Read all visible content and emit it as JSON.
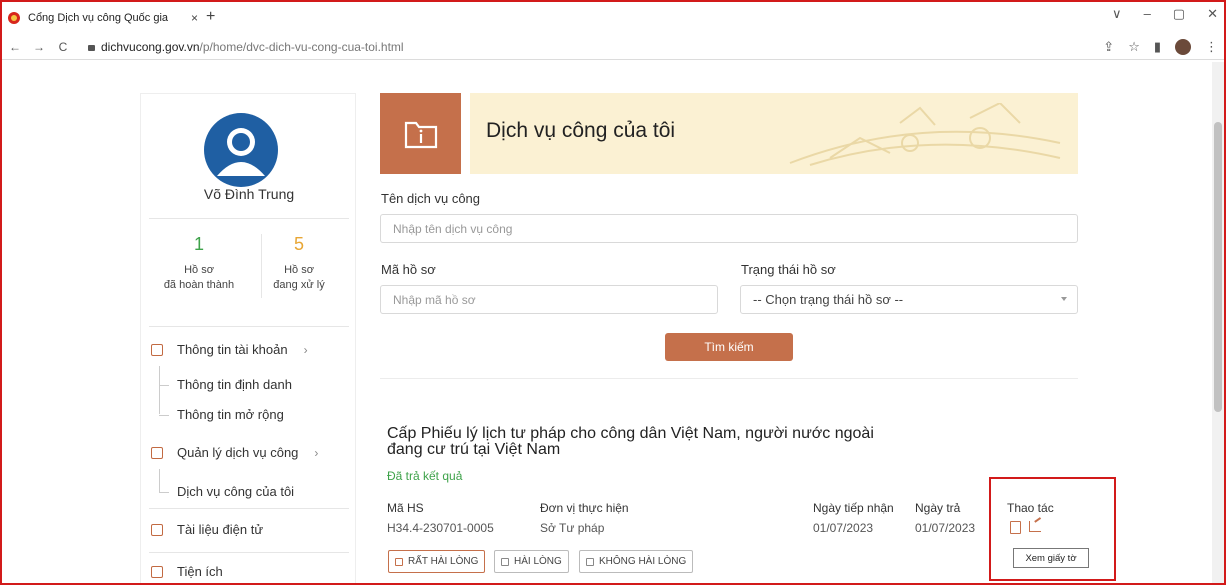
{
  "browser": {
    "tab_title": "Cổng Dịch vụ công Quốc gia",
    "tab_close": "×",
    "new_tab": "+",
    "url_host": "dichvucong.gov.vn",
    "url_path": "/p/home/dvc-dich-vu-cong-cua-toi.html",
    "window_controls": [
      "∨",
      "–",
      "▢",
      "✕"
    ]
  },
  "sidebar": {
    "user_name": "Võ Đình Trung",
    "stats": [
      {
        "value": "1",
        "label_line1": "Hồ sơ",
        "label_line2": "đã hoàn thành",
        "color": "#3ea24a"
      },
      {
        "value": "5",
        "label_line1": "Hồ sơ",
        "label_line2": "đang xử lý",
        "color": "#e8a634"
      }
    ],
    "menu": {
      "account": "Thông tin tài khoản",
      "account_sub": [
        "Thông tin định danh",
        "Thông tin mở rộng"
      ],
      "services": "Quản lý dịch vụ công",
      "services_sub": [
        "Dịch vụ công của tôi"
      ],
      "documents": "Tài liệu điện tử",
      "utilities": "Tiện ích"
    }
  },
  "main": {
    "banner_title": "Dịch vụ công của tôi",
    "service_name_label": "Tên dịch vụ công",
    "service_name_placeholder": "Nhập tên dịch vụ công",
    "case_code_label": "Mã hồ sơ",
    "case_code_placeholder": "Nhập mã hồ sơ",
    "status_label": "Trạng thái hồ sơ",
    "status_selected": "-- Chọn trạng thái hồ sơ --",
    "search_button": "Tìm kiếm"
  },
  "case": {
    "title": "Cấp Phiếu lý lịch tư pháp cho công dân Việt Nam, người nước ngoài đang cư trú tại Việt Nam",
    "status": "Đã trả kết quả",
    "headers": {
      "code": "Mã HS",
      "unit": "Đơn vị thực hiện",
      "received": "Ngày tiếp nhận",
      "returned": "Ngày trả",
      "actions": "Thao tác"
    },
    "values": {
      "code": "H34.4-230701-0005",
      "unit": "Sở Tư pháp",
      "received": "01/07/2023",
      "returned": "01/07/2023"
    },
    "ratings": [
      "RẤT HÀI LÒNG",
      "HÀI LÒNG",
      "KHÔNG HÀI LÒNG"
    ],
    "tooltip": "Xem giấy tờ"
  },
  "colors": {
    "accent": "#c5704b",
    "banner_bg": "#fbf1d3",
    "highlight": "#d21a1a"
  }
}
